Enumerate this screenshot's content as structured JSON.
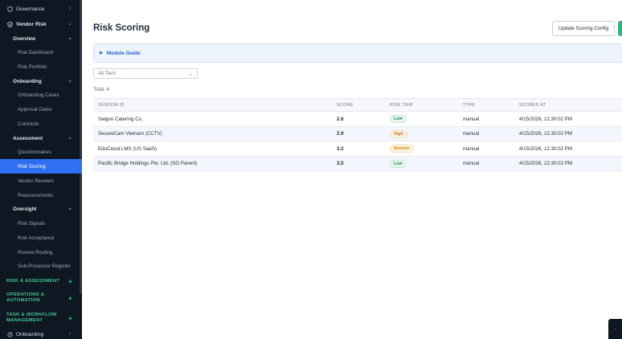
{
  "sidebar": {
    "top_items": [
      {
        "label": "Governance",
        "icon": "shield-icon"
      },
      {
        "label": "Vendor Risk",
        "icon": "shield-check-icon"
      }
    ],
    "groups": [
      {
        "label": "Overview",
        "items": [
          "Risk Dashboard",
          "Risk Portfolio"
        ]
      },
      {
        "label": "Onboarding",
        "items": [
          "Onboarding Cases",
          "Approval Gates",
          "Contracts"
        ]
      },
      {
        "label": "Assessment",
        "items": [
          "Questionnaires",
          "Risk Scoring",
          "Vendor Reviews",
          "Reassessments"
        ]
      },
      {
        "label": "Oversight",
        "items": [
          "Risk Signals",
          "Risk Acceptance",
          "Review Routing",
          "Sub-Processor Register"
        ]
      }
    ],
    "active_item": "Risk Scoring",
    "sections": [
      "RISK & ASSESSMENT",
      "OPERATIONS & AUTOMATION",
      "TASK & WORKFLOW MANAGEMENT"
    ],
    "bottom_item": {
      "label": "Onboarding",
      "icon": "clock-icon"
    }
  },
  "header": {
    "title": "Risk Scoring",
    "config_button": "Update Scoring Config"
  },
  "guide": {
    "label": "Module Guide"
  },
  "filter": {
    "selected": "All Tiers"
  },
  "total": "Total: 4",
  "table": {
    "columns": [
      "VENDOR ID",
      "SCORE",
      "RISK TIER",
      "TYPE",
      "SCORED AT"
    ],
    "rows": [
      {
        "vendor": "Saigon Catering Co.",
        "score": "2.6",
        "tier": "Low",
        "type": "manual",
        "scored_at": "4/15/2026, 12:30:02 PM"
      },
      {
        "vendor": "SecureCam Vietnam (CCTV)",
        "score": "2.9",
        "tier": "High",
        "type": "manual",
        "scored_at": "4/15/2026, 12:30:02 PM"
      },
      {
        "vendor": "EduCloud LMS (US SaaS)",
        "score": "3.2",
        "tier": "Medium",
        "type": "manual",
        "scored_at": "4/15/2026, 12:30:02 PM"
      },
      {
        "vendor": "Pacific Bridge Holdings Pte. Ltd. (SG Parent)",
        "score": "3.5",
        "tier": "Low",
        "type": "manual",
        "scored_at": "4/15/2026, 12:30:02 PM"
      }
    ]
  },
  "colors": {
    "accent": "#2f6ff2",
    "sidebar_bg": "#0f1722",
    "section": "#3ec98e",
    "primary_green": "#2fb57a"
  }
}
